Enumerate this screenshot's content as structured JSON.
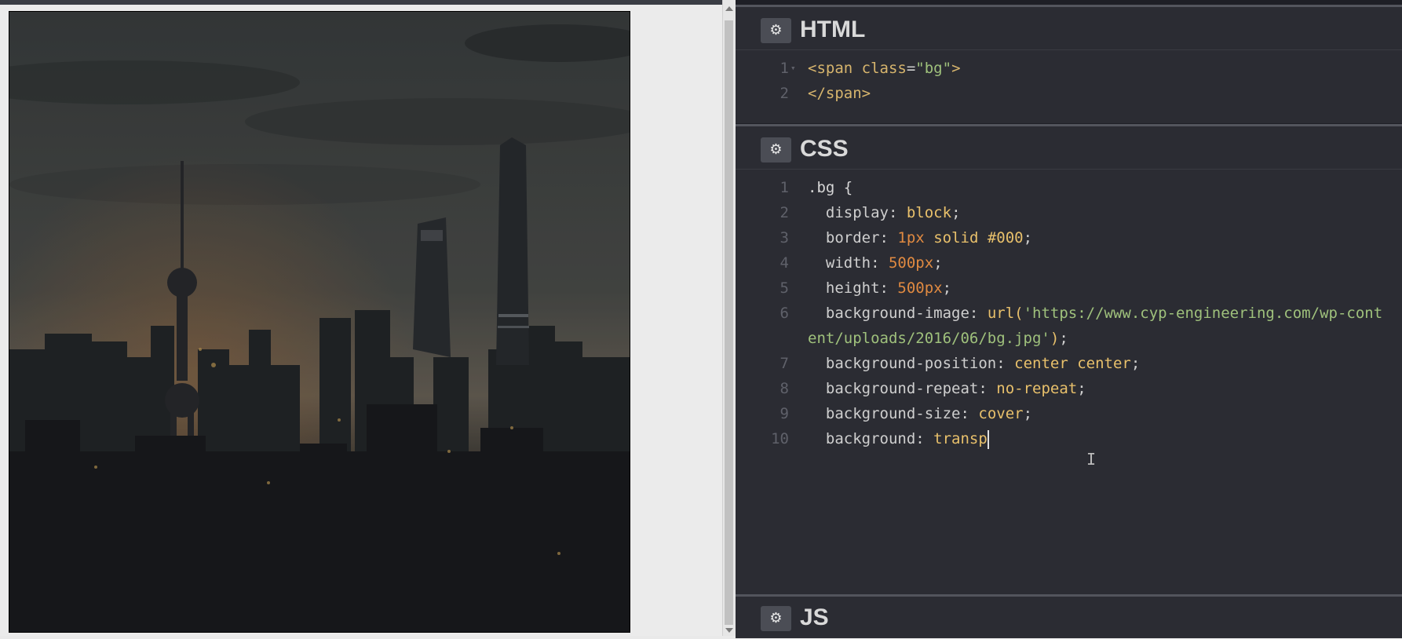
{
  "html_panel": {
    "title": "HTML",
    "settings_icon": "gear-icon",
    "lines": [
      {
        "n": "1",
        "parts": [
          {
            "c": "t-tag",
            "t": "<span "
          },
          {
            "c": "t-attr",
            "t": "class"
          },
          {
            "c": "t-punc",
            "t": "="
          },
          {
            "c": "t-str",
            "t": "\"bg\""
          },
          {
            "c": "t-tag",
            "t": ">"
          }
        ]
      },
      {
        "n": "2",
        "parts": [
          {
            "c": "t-tag",
            "t": "</span>"
          }
        ]
      }
    ]
  },
  "css_panel": {
    "title": "CSS",
    "settings_icon": "gear-icon",
    "lines": [
      {
        "n": "1",
        "parts": [
          {
            "c": "t-sel",
            "t": ".bg {"
          }
        ]
      },
      {
        "n": "2",
        "parts": [
          {
            "c": "t-prop",
            "t": "  display"
          },
          {
            "c": "t-punc",
            "t": ": "
          },
          {
            "c": "t-val",
            "t": "block"
          },
          {
            "c": "t-punc",
            "t": ";"
          }
        ]
      },
      {
        "n": "3",
        "parts": [
          {
            "c": "t-prop",
            "t": "  border"
          },
          {
            "c": "t-punc",
            "t": ": "
          },
          {
            "c": "t-num",
            "t": "1px"
          },
          {
            "c": "t-val",
            "t": " solid #000"
          },
          {
            "c": "t-punc",
            "t": ";"
          }
        ]
      },
      {
        "n": "4",
        "parts": [
          {
            "c": "t-prop",
            "t": "  width"
          },
          {
            "c": "t-punc",
            "t": ": "
          },
          {
            "c": "t-num",
            "t": "500px"
          },
          {
            "c": "t-punc",
            "t": ";"
          }
        ]
      },
      {
        "n": "5",
        "parts": [
          {
            "c": "t-prop",
            "t": "  height"
          },
          {
            "c": "t-punc",
            "t": ": "
          },
          {
            "c": "t-num",
            "t": "500px"
          },
          {
            "c": "t-punc",
            "t": ";"
          }
        ]
      },
      {
        "n": "6",
        "wrap": true,
        "parts": [
          {
            "c": "t-prop",
            "t": "  background-image"
          },
          {
            "c": "t-punc",
            "t": ": "
          },
          {
            "c": "t-val",
            "t": "url("
          },
          {
            "c": "t-str",
            "t": "'https://www.cyp-engineering.com/wp-content/uploads/2016/06/bg.jpg'"
          },
          {
            "c": "t-val",
            "t": ")"
          },
          {
            "c": "t-punc",
            "t": ";"
          }
        ]
      },
      {
        "n": "7",
        "parts": [
          {
            "c": "t-prop",
            "t": "  background-position"
          },
          {
            "c": "t-punc",
            "t": ": "
          },
          {
            "c": "t-val",
            "t": "center center"
          },
          {
            "c": "t-punc",
            "t": ";"
          }
        ]
      },
      {
        "n": "8",
        "parts": [
          {
            "c": "t-prop",
            "t": "  background-repeat"
          },
          {
            "c": "t-punc",
            "t": ": "
          },
          {
            "c": "t-val",
            "t": "no-repeat"
          },
          {
            "c": "t-punc",
            "t": ";"
          }
        ]
      },
      {
        "n": "9",
        "parts": [
          {
            "c": "t-prop",
            "t": "  background-size"
          },
          {
            "c": "t-punc",
            "t": ": "
          },
          {
            "c": "t-val",
            "t": "cover"
          },
          {
            "c": "t-punc",
            "t": ";"
          }
        ]
      },
      {
        "n": "10",
        "cursor": true,
        "parts": [
          {
            "c": "t-prop",
            "t": "  background"
          },
          {
            "c": "t-punc",
            "t": ": "
          },
          {
            "c": "t-val",
            "t": "transp"
          }
        ]
      }
    ]
  },
  "js_panel": {
    "title": "JS",
    "settings_icon": "gear-icon"
  },
  "preview": {
    "image_icon": "city-skyline-photo"
  }
}
